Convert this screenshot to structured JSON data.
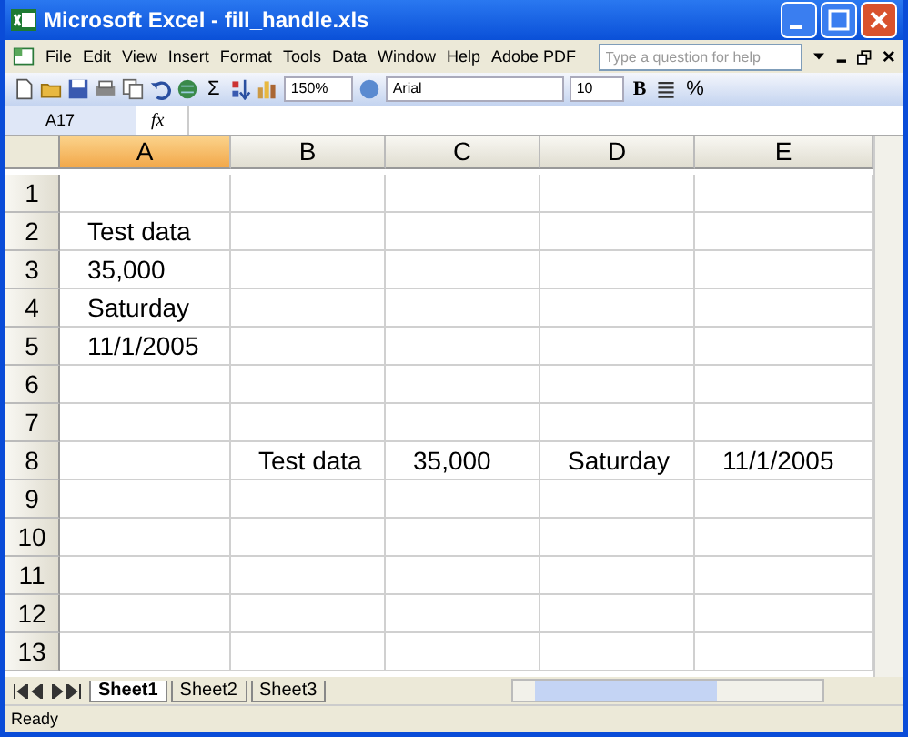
{
  "window": {
    "title": "Microsoft Excel - fill_handle.xls"
  },
  "menu": [
    "File",
    "Edit",
    "View",
    "Insert",
    "Format",
    "Tools",
    "Data",
    "Window",
    "Help",
    "Adobe PDF"
  ],
  "help_field": {
    "placeholder": "Type a question for help"
  },
  "toolbar": {
    "sum": "Σ",
    "zoom": "150%",
    "font": "Arial",
    "size": "10",
    "bold": "B",
    "percent": "%"
  },
  "formula_bar": {
    "name_box": "A17",
    "fx": "fx"
  },
  "columns": [
    {
      "label": "A",
      "selected": true
    },
    {
      "label": "B",
      "selected": false
    },
    {
      "label": "C",
      "selected": false
    },
    {
      "label": "D",
      "selected": false
    },
    {
      "label": "E",
      "selected": false
    }
  ],
  "rows": [
    {
      "label": "1"
    },
    {
      "label": "2",
      "cells": [
        "Test data",
        null,
        null,
        null,
        null
      ]
    },
    {
      "label": "3",
      "cells": [
        "35,000",
        null,
        null,
        null,
        null
      ]
    },
    {
      "label": "4",
      "cells": [
        "Saturday",
        null,
        null,
        null,
        null
      ]
    },
    {
      "label": "5",
      "cells": [
        "11/1/2005",
        null,
        null,
        null,
        null
      ]
    },
    {
      "label": "6"
    },
    {
      "label": "7"
    },
    {
      "label": "8",
      "cells": [
        null,
        "Test data",
        "35,000",
        "Saturday",
        "11/1/2005"
      ]
    },
    {
      "label": "9"
    },
    {
      "label": "10"
    },
    {
      "label": "11"
    },
    {
      "label": "12"
    },
    {
      "label": "13"
    }
  ],
  "sheets": [
    {
      "label": "Sheet1",
      "selected": true
    },
    {
      "label": "Sheet2",
      "selected": false
    },
    {
      "label": "Sheet3",
      "selected": false
    }
  ],
  "status_bar": {
    "text": "Ready"
  }
}
